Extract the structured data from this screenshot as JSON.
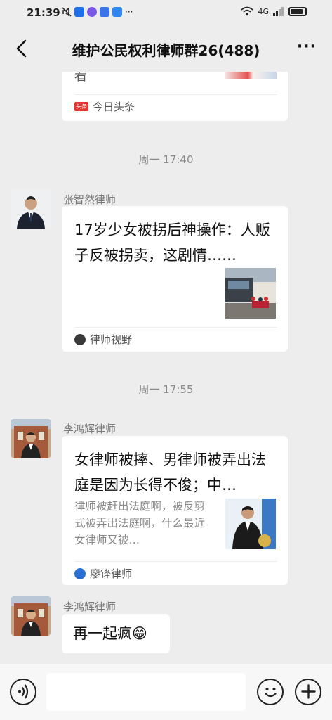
{
  "status_bar": {
    "time": "21:39",
    "network": "4G",
    "more": "···",
    "icon_colors": [
      "#1e6ee8",
      "#7a58e6",
      "#3a73e8",
      "#2f86f0"
    ]
  },
  "header": {
    "title": "维护公民权利律师群26(488)",
    "back_icon": "chevron-left-icon",
    "more": "···"
  },
  "messages": [
    {
      "type": "article-partial",
      "tail_text": "看",
      "source": "今日头条",
      "source_badge": "头条"
    },
    {
      "type": "timestamp",
      "text": "周一 17:40"
    },
    {
      "type": "article",
      "sender": "张智然律师",
      "title": "17岁少女被拐后神操作：人贩子反被拐卖，这剧情……",
      "source": "律师视野"
    },
    {
      "type": "timestamp",
      "text": "周一 17:55"
    },
    {
      "type": "article",
      "sender": "李鸿辉律师",
      "title": "女律师被摔、男律师被弄出法庭是因为长得不俊；中…",
      "description": "律师被赶出法庭啊，被反剪式被弄出法庭啊，什么最近女律师又被…",
      "source": "廖锋律师"
    },
    {
      "type": "text",
      "sender": "李鸿辉律师",
      "text": "再一起疯😁"
    }
  ],
  "input_bar": {
    "voice_icon": "voice-icon",
    "emoji_icon": "emoji-icon",
    "plus_icon": "plus-icon"
  }
}
